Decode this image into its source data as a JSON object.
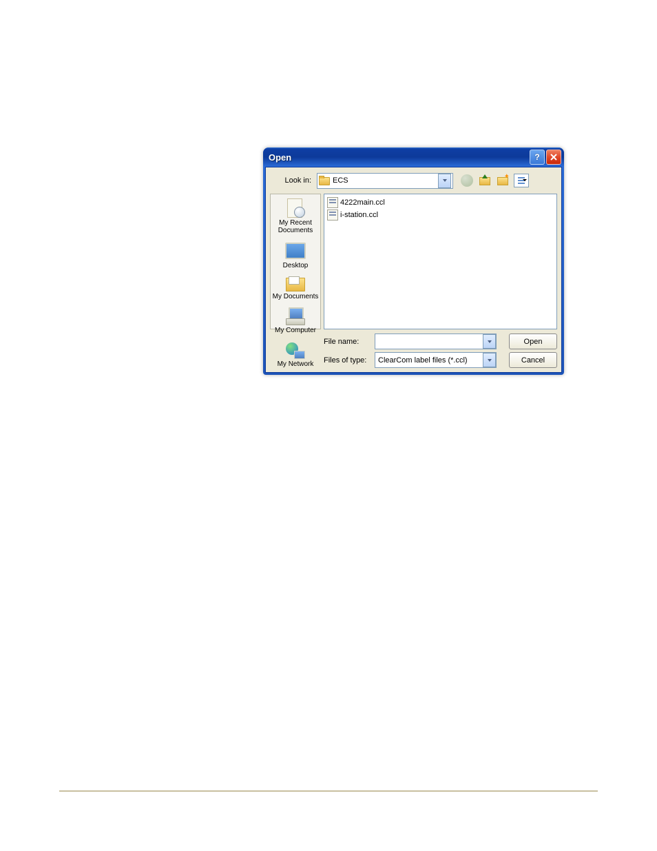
{
  "dialog": {
    "title": "Open",
    "lookin_label": "Look in:",
    "lookin_value": "ECS",
    "places": [
      {
        "label": "My Recent\nDocuments"
      },
      {
        "label": "Desktop"
      },
      {
        "label": "My Documents"
      },
      {
        "label": "My Computer"
      },
      {
        "label": "My Network"
      }
    ],
    "files": [
      {
        "name": "4222main.ccl"
      },
      {
        "name": "i-station.ccl"
      }
    ],
    "filename_label": "File name:",
    "filename_value": "",
    "filetype_label": "Files of type:",
    "filetype_value": "ClearCom label files (*.ccl)",
    "open_button": "Open",
    "cancel_button": "Cancel"
  }
}
